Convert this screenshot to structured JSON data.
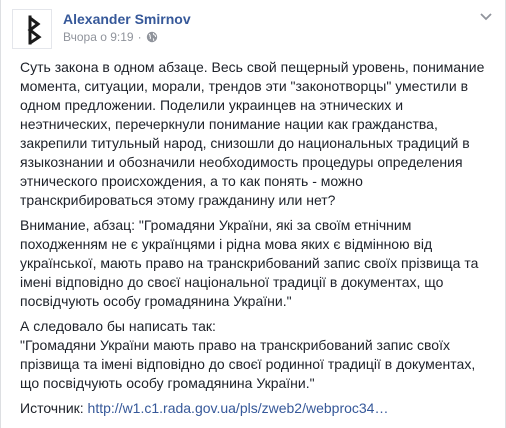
{
  "post": {
    "author": "Alexander Smirnov",
    "time": "Вчора о 9:19",
    "separator": "·",
    "icons": {
      "avatar": "rune-avatar",
      "privacy": "globe-icon",
      "menu": "chevron-down-icon"
    },
    "paragraphs": [
      "Суть закона в одном абзаце. Весь свой пещерный уровень, понимание\nмомента, ситуации, морали, трендов эти \"законотворцы\" уместили в\nодном предложении. Поделили украинцев на этнических и\nнеэтнических, перечеркнули понимание нации как гражданства,\nзакрепили титульный народ, снизошли до национальных традиций в\nязыкознании и обозначили необходимость процедуры определения\nэтнического происхождения, а то как понять - можно\nтранскрибироваться этому гражданину или нет?",
      "Внимание, абзац: \"Громадяни України, які за своїм етнічним\nпоходженням не є українцями і рідна мова яких є відмінною від\nукраїнської, мають право на транскрибований запис своїх прізвища та\nімені відповідно до своєї національної традиції в документах, що\nпосвідчують особу громадянина України.\"",
      "А следовало бы написать так:\n\"Громадяни України мають право на транскрибований запис своїх\nпрізвища та імені відповідно до своєї родинної традиції в документах,\nщо посвідчують особу громадянина України.\""
    ],
    "source_label": "Источник: ",
    "source_link": "http://w1.c1.rada.gov.ua/pls/zweb2/webproc34…"
  }
}
